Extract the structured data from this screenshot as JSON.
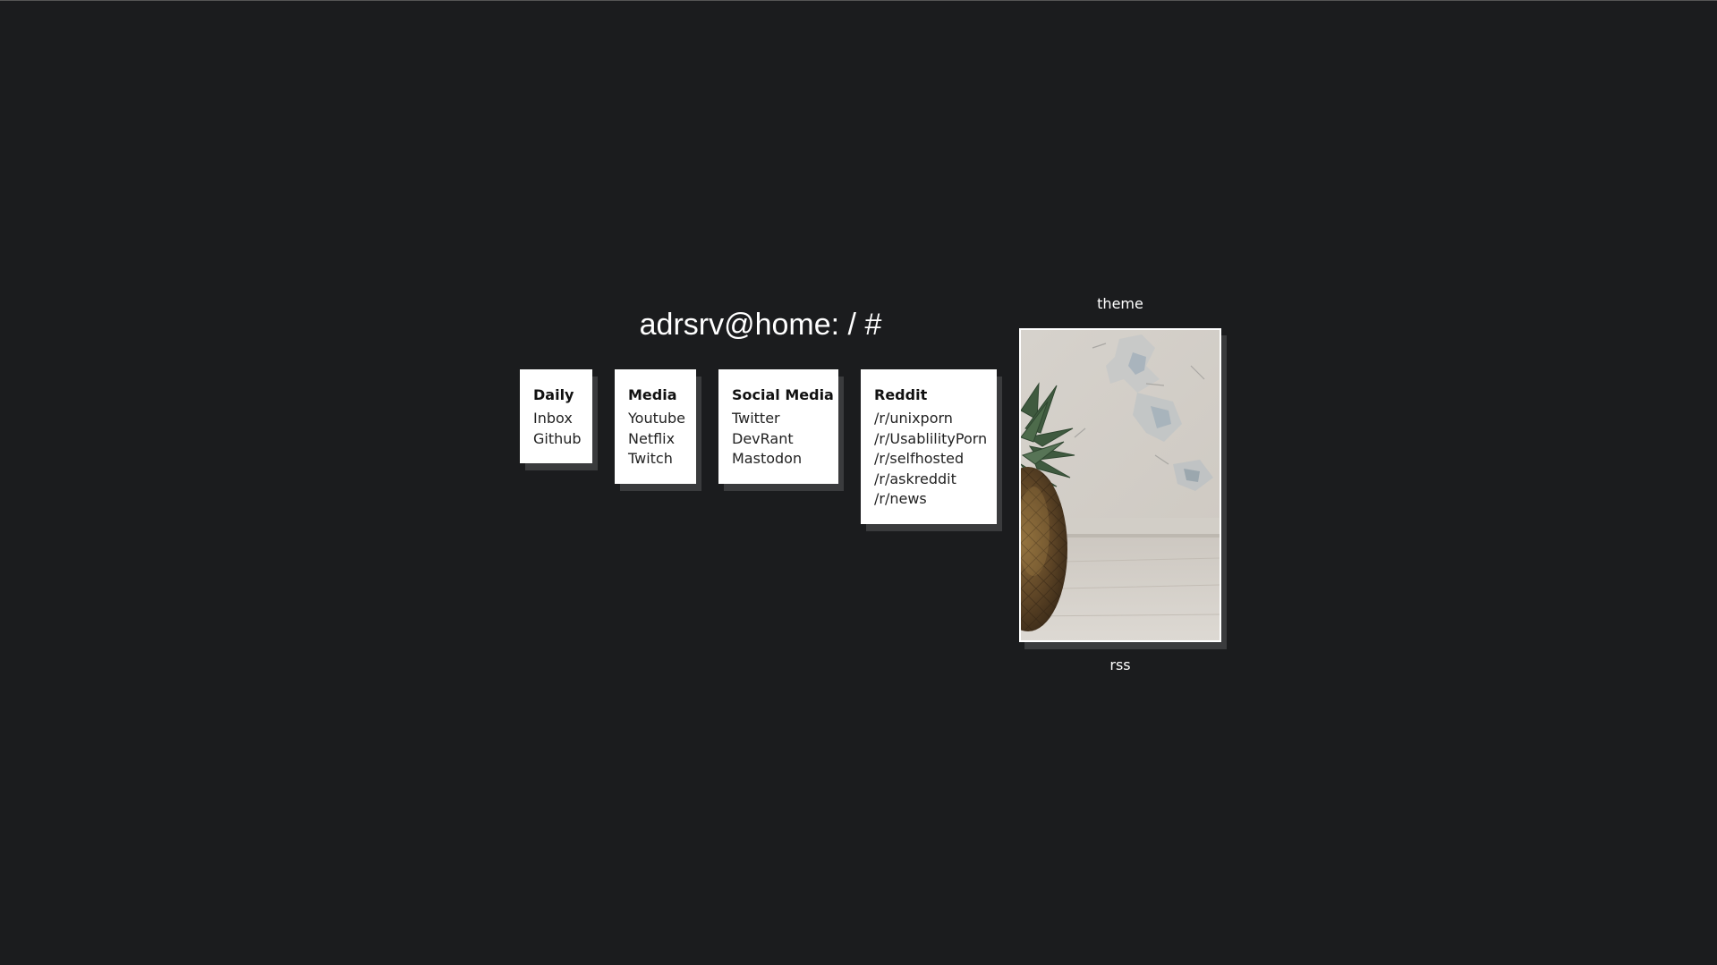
{
  "title": "adrsrv@home: / #",
  "cards": [
    {
      "title": "Daily",
      "links": [
        "Inbox",
        "Github"
      ]
    },
    {
      "title": "Media",
      "links": [
        "Youtube",
        "Netflix",
        "Twitch"
      ]
    },
    {
      "title": "Social Media",
      "links": [
        "Twitter",
        "DevRant",
        "Mastodon"
      ]
    },
    {
      "title": "Reddit",
      "links": [
        "/r/unixporn",
        "/r/UsablilityPorn",
        "/r/selfhosted",
        "/r/askreddit",
        "/r/news"
      ]
    }
  ],
  "side": {
    "theme_label": "theme",
    "rss_label": "rss",
    "image": "pineapple-photo"
  },
  "colors": {
    "background": "#1b1c1e",
    "card": "#ffffff",
    "shadow": "#3a3b3d",
    "text": "#222222"
  }
}
